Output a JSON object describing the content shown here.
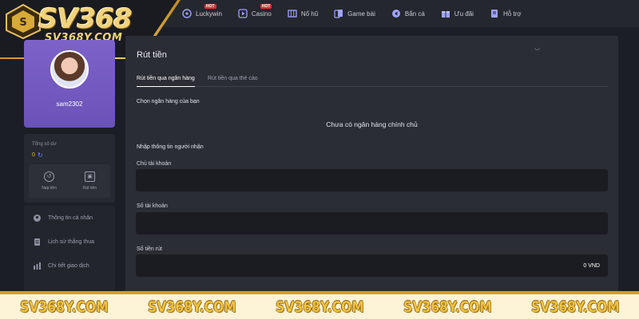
{
  "brand": {
    "logo": "SV368",
    "domain": "SV368Y.COM"
  },
  "nav": {
    "items": [
      {
        "label": "Luckywin",
        "icon": "lucky-wheel-icon",
        "badge": "HOT"
      },
      {
        "label": "Casino",
        "icon": "casino-play-icon",
        "badge": "HOT"
      },
      {
        "label": "Nổ hũ",
        "icon": "slot-machine-icon",
        "badge": ""
      },
      {
        "label": "Game bài",
        "icon": "cards-icon",
        "badge": ""
      },
      {
        "label": "Bắn cá",
        "icon": "fish-icon",
        "badge": ""
      },
      {
        "label": "Ưu đãi",
        "icon": "gift-icon",
        "badge": ""
      },
      {
        "label": "Hỗ trợ",
        "icon": "support-book-icon",
        "badge": ""
      }
    ]
  },
  "profile": {
    "username": "sam2302"
  },
  "balance": {
    "label": "Tổng số dư",
    "value": "0",
    "actions": [
      {
        "label": "Nạp tiền",
        "icon": "deposit-icon"
      },
      {
        "label": "Rút tiền",
        "icon": "withdraw-icon"
      }
    ]
  },
  "menu": {
    "items": [
      {
        "label": "Thông tin cá nhân",
        "icon": "user-icon"
      },
      {
        "label": "Lịch sử thắng thua",
        "icon": "history-icon"
      },
      {
        "label": "Chi tiết giao dịch",
        "icon": "transactions-icon"
      }
    ]
  },
  "panel": {
    "title": "Rút tiền",
    "tabs": [
      {
        "label": "Rút tiền qua ngân hàng",
        "active": true
      },
      {
        "label": "Rút tiền qua thẻ cào",
        "active": false
      }
    ],
    "bank_section_label": "Chọn ngân hàng của bạn",
    "empty_message": "Chưa có ngân hàng chính chủ",
    "recipient_section_label": "Nhập thông tin người nhận",
    "fields": {
      "account_holder_label": "Chủ tài khoản",
      "account_holder_value": "",
      "account_number_label": "Số tài khoản",
      "account_number_value": "",
      "amount_label": "Số tiền rút",
      "amount_value": "0 VND"
    }
  },
  "footer": {
    "watermarks": [
      "SV368Y.COM",
      "SV368Y.COM",
      "SV368Y.COM",
      "SV368Y.COM",
      "SV368Y.COM"
    ]
  },
  "colors": {
    "accent_gold": "#e0b93e",
    "profile_purple": "#7461c5",
    "panel_bg": "#2b2d35"
  }
}
